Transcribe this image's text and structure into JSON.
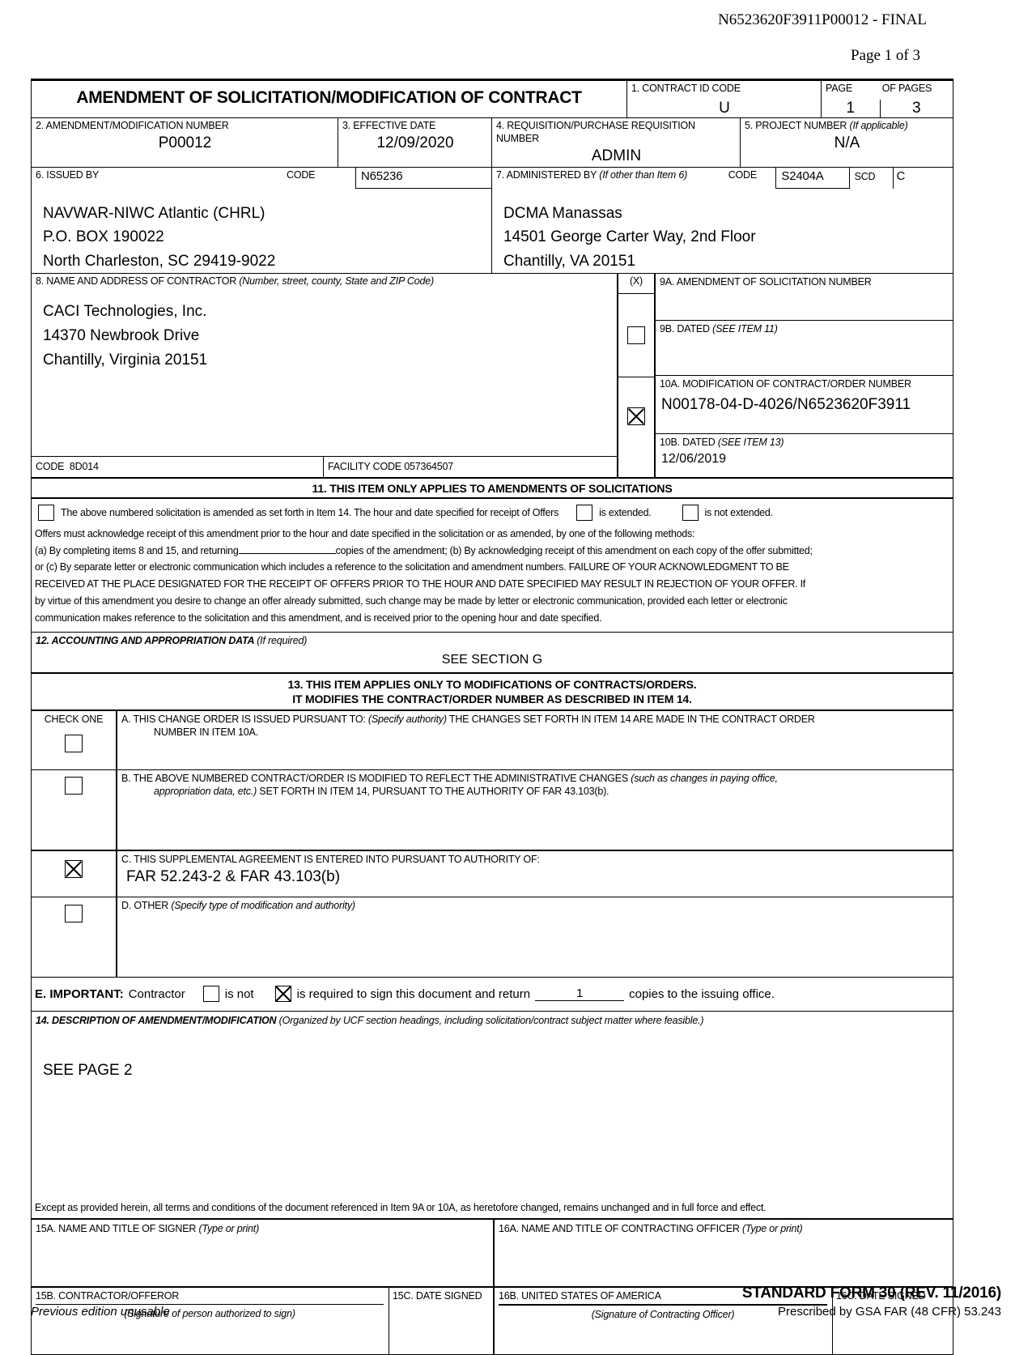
{
  "header": {
    "doc_id": "N6523620F3911P00012 - FINAL",
    "page_indicator": "Page 1 of 3"
  },
  "form": {
    "title": "AMENDMENT OF SOLICITATION/MODIFICATION OF CONTRACT",
    "item1": {
      "label": "1. CONTRACT ID CODE",
      "value": "U"
    },
    "pages": {
      "page_label": "PAGE",
      "of_label": "OF  PAGES",
      "page": "1",
      "of_pages": "3"
    },
    "item2": {
      "label": "2. AMENDMENT/MODIFICATION NUMBER",
      "value": "P00012"
    },
    "item3": {
      "label": "3. EFFECTIVE DATE",
      "value": "12/09/2020"
    },
    "item4": {
      "label": "4. REQUISITION/PURCHASE REQUISITION NUMBER",
      "value": "ADMIN"
    },
    "item5": {
      "label": "5. PROJECT NUMBER ",
      "label_italic": "(If applicable)",
      "value": "N/A"
    },
    "item6": {
      "label": "6.  ISSUED BY",
      "code_label": "CODE",
      "code_value": "N65236",
      "address": [
        "NAVWAR-NIWC Atlantic (CHRL)",
        "P.O. BOX 190022",
        "North Charleston, SC 29419-9022"
      ]
    },
    "item7": {
      "label": "7. ADMINISTERED BY ",
      "label_italic": "(If other than Item 6)",
      "code_label": "CODE",
      "code_value": "S2404A",
      "scd_label": "SCD",
      "scd_value": "C",
      "address": [
        "DCMA Manassas",
        "14501 George Carter Way, 2nd Floor",
        "Chantilly, VA 20151"
      ]
    },
    "item8": {
      "label": "8.  NAME AND ADDRESS OF CONTRACTOR ",
      "label_italic": "(Number, street, county, State and ZIP Code)",
      "address": [
        "CACI Technologies, Inc.",
        "14370 Newbrook Drive",
        "Chantilly, Virginia 20151"
      ],
      "code_label": "CODE",
      "code_value": "8D014",
      "facility_label": "FACILITY CODE",
      "facility_value": "057364507"
    },
    "x_col_header": "(X)",
    "item9a": {
      "label": "9A. AMENDMENT OF SOLICITATION NUMBER",
      "value": "",
      "checked": false
    },
    "item9b": {
      "label": "9B. DATED ",
      "label_italic": "(SEE ITEM 11)",
      "value": ""
    },
    "item10a": {
      "label": "10A. MODIFICATION OF CONTRACT/ORDER NUMBER",
      "value": "N00178-04-D-4026/N6523620F3911",
      "checked": true
    },
    "item10b": {
      "label": "10B. DATED ",
      "label_italic": "(SEE ITEM 13)",
      "value": "12/06/2019"
    },
    "item11": {
      "band": "11.  THIS ITEM ONLY APPLIES TO AMENDMENTS OF SOLICITATIONS",
      "line1": "The above numbered solicitation is amended as set forth in Item 14.  The hour and date specified for receipt of Offers",
      "extended_label": "is extended.",
      "not_extended_label": "is not extended.",
      "p1": "Offers must acknowledge receipt of this amendment prior to the hour and date specified in the solicitation or as amended, by one of the following methods:",
      "p2a": "(a) By completing items 8 and 15, and returning",
      "p2b": "copies of the amendment; (b) By acknowledging receipt of this amendment on each copy of the offer submitted;",
      "p3": "or (c) By separate letter or electronic communication which includes a reference to the solicitation and amendment numbers.  FAILURE OF YOUR ACKNOWLEDGMENT TO BE",
      "p4": "RECEIVED AT THE PLACE DESIGNATED FOR THE RECEIPT OF OFFERS PRIOR TO THE HOUR AND DATE SPECIFIED MAY RESULT IN REJECTION OF YOUR OFFER. If",
      "p5": "by virtue of this amendment you desire to change an offer already submitted, such change may be made by letter or electronic communication, provided each letter or electronic",
      "p6": "communication makes reference to the solicitation and this amendment, and is received prior to the opening hour and date specified."
    },
    "item12": {
      "label": "12.  ACCOUNTING AND APPROPRIATION DATA ",
      "label_italic": "(If required)",
      "value": "SEE SECTION G"
    },
    "item13": {
      "band_line1": "13.  THIS ITEM APPLIES ONLY TO MODIFICATIONS OF CONTRACTS/ORDERS.",
      "band_line2": "IT MODIFIES THE CONTRACT/ORDER NUMBER AS DESCRIBED IN ITEM 14.",
      "check_one_label": "CHECK ONE",
      "a": {
        "text1": "A.  THIS CHANGE ORDER IS ISSUED PURSUANT TO:  ",
        "italic": "(Specify authority)",
        "text2": " THE CHANGES SET FORTH IN ITEM 14 ARE MADE IN THE CONTRACT ORDER",
        "text3": "NUMBER IN ITEM 10A.",
        "checked": false
      },
      "b": {
        "text1": "B.  THE ABOVE NUMBERED CONTRACT/ORDER IS MODIFIED TO REFLECT THE ADMINISTRATIVE CHANGES ",
        "italic": "(such as changes in paying office,",
        "italic2": "appropriation data, etc.)",
        "text2": " SET FORTH IN ITEM 14, PURSUANT TO THE AUTHORITY OF FAR 43.103(b).",
        "checked": false
      },
      "c": {
        "text1": "C.  THIS SUPPLEMENTAL AGREEMENT IS ENTERED INTO PURSUANT TO AUTHORITY OF:",
        "value": "FAR 52.243-2 & FAR 43.103(b)",
        "checked": true
      },
      "d": {
        "text1": "D.  OTHER ",
        "italic": "(Specify type of modification and authority)",
        "checked": false
      }
    },
    "item_e": {
      "bold": "E. IMPORTANT:",
      "t1": "Contractor",
      "is_not_label": "is not",
      "is_required_label": "is required to sign this document and return",
      "copies_value": "1",
      "t2": "copies to the issuing office.",
      "is_not_checked": false,
      "is_required_checked": true
    },
    "item14": {
      "label": "14.  DESCRIPTION OF AMENDMENT/MODIFICATION ",
      "label_italic": "(Organized by UCF section headings, including solicitation/contract subject matter where feasible.)",
      "body": "SEE PAGE 2"
    },
    "except_clause": "Except as provided herein, all terms and conditions of the document referenced in Item 9A or 10A, as heretofore changed, remains unchanged and in full force and effect.",
    "item15a": {
      "label": "15A. NAME AND TITLE OF SIGNER ",
      "label_italic": "(Type or print)",
      "value": ""
    },
    "item16a": {
      "label": "16A. NAME AND TITLE OF CONTRACTING OFFICER ",
      "label_italic": "(Type or print)",
      "value": ""
    },
    "item15b": {
      "label": "15B. CONTRACTOR/OFFEROR",
      "sig_hint": "(Signature of person authorized to sign)"
    },
    "item15c": {
      "label": "15C. DATE SIGNED",
      "value": ""
    },
    "item16b": {
      "label": "16B. UNITED STATES OF AMERICA",
      "sig_hint": "(Signature of Contracting Officer)"
    },
    "item16c": {
      "label": "16C. DATE SIGNED",
      "value": ""
    }
  },
  "footer": {
    "previous_edition": "Previous edition unusable",
    "standard_form": "STANDARD FORM 30 (REV. 11/2016)",
    "prescribed": "Prescribed by GSA FAR (48 CFR) 53.243"
  }
}
